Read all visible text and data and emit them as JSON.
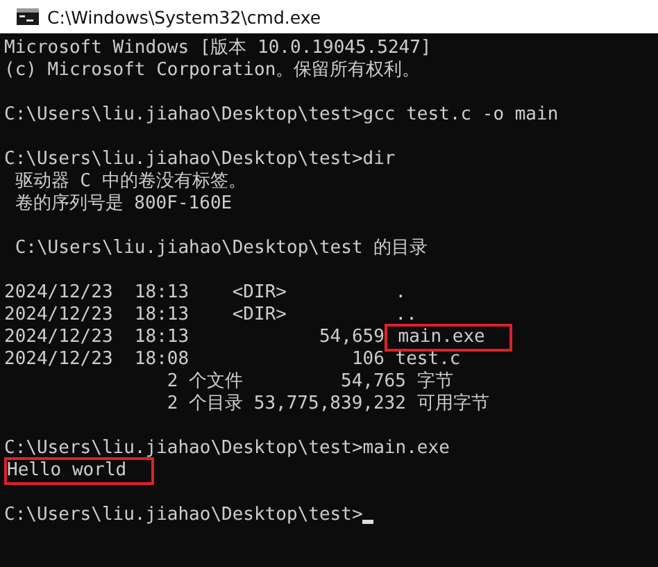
{
  "window": {
    "title": "C:\\Windows\\System32\\cmd.exe"
  },
  "terminal": {
    "cursor_visible": true,
    "lines": [
      {
        "kind": "output",
        "parts": [
          {
            "text": "Microsoft Windows [版本 10.0.19045.5247]",
            "highlighted": false
          }
        ]
      },
      {
        "kind": "output",
        "parts": [
          {
            "text": "(c) Microsoft Corporation。保留所有权利。",
            "highlighted": false
          }
        ]
      },
      {
        "kind": "blank"
      },
      {
        "kind": "output",
        "parts": [
          {
            "text": "C:\\Users\\liu.jiahao\\Desktop\\test>gcc test.c -o main",
            "highlighted": false
          }
        ]
      },
      {
        "kind": "blank"
      },
      {
        "kind": "output",
        "parts": [
          {
            "text": "C:\\Users\\liu.jiahao\\Desktop\\test>dir",
            "highlighted": false
          }
        ]
      },
      {
        "kind": "output",
        "parts": [
          {
            "text": " 驱动器 C 中的卷没有标签。",
            "highlighted": false
          }
        ]
      },
      {
        "kind": "output",
        "parts": [
          {
            "text": " 卷的序列号是 800F-160E",
            "highlighted": false
          }
        ]
      },
      {
        "kind": "blank"
      },
      {
        "kind": "output",
        "parts": [
          {
            "text": " C:\\Users\\liu.jiahao\\Desktop\\test 的目录",
            "highlighted": false
          }
        ]
      },
      {
        "kind": "blank"
      },
      {
        "kind": "output",
        "parts": [
          {
            "text": "2024/12/23  18:13    <DIR>          .",
            "highlighted": false
          }
        ]
      },
      {
        "kind": "output",
        "parts": [
          {
            "text": "2024/12/23  18:13    <DIR>          ..",
            "highlighted": false
          }
        ]
      },
      {
        "kind": "output",
        "parts": [
          {
            "text": "2024/12/23  18:13            54,659",
            "highlighted": false
          },
          {
            "text": " main.exe",
            "highlighted": true
          }
        ]
      },
      {
        "kind": "output",
        "parts": [
          {
            "text": "2024/12/23  18:08               106 test.c",
            "highlighted": false
          }
        ]
      },
      {
        "kind": "output",
        "parts": [
          {
            "text": "               2 个文件         54,765 字节",
            "highlighted": false
          }
        ]
      },
      {
        "kind": "output",
        "parts": [
          {
            "text": "               2 个目录 53,775,839,232 可用字节",
            "highlighted": false
          }
        ]
      },
      {
        "kind": "blank"
      },
      {
        "kind": "output",
        "parts": [
          {
            "text": "C:\\Users\\liu.jiahao\\Desktop\\test>main.exe",
            "highlighted": false
          }
        ]
      },
      {
        "kind": "output",
        "parts": [
          {
            "text": "Hello world",
            "highlighted": true
          }
        ]
      },
      {
        "kind": "blank"
      },
      {
        "kind": "output",
        "parts": [
          {
            "text": "C:\\Users\\liu.jiahao\\Desktop\\test>",
            "highlighted": false
          }
        ],
        "cursor": true
      }
    ]
  }
}
